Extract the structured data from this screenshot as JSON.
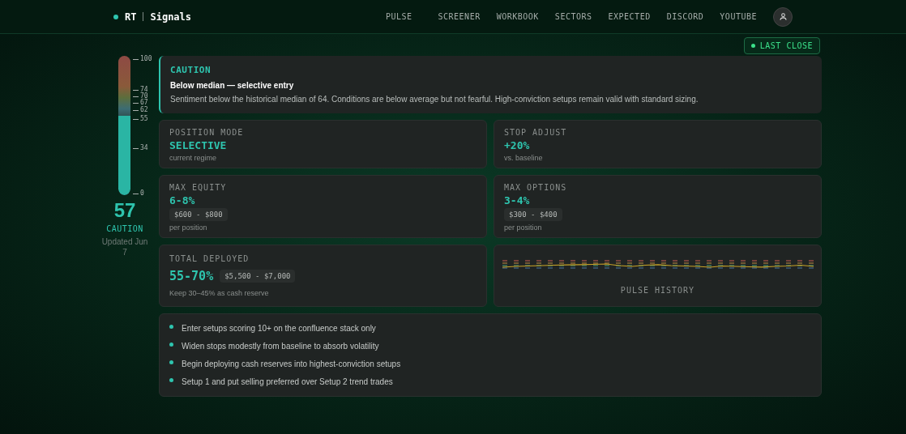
{
  "brand": {
    "name": "RT",
    "section": "Signals"
  },
  "nav": [
    "PULSE",
    "SCREENER",
    "WORKBOOK",
    "SECTORS",
    "EXPECTED",
    "DISCORD",
    "YOUTUBE"
  ],
  "status_badge": "LAST CLOSE",
  "gauge": {
    "level": 0.57,
    "ticks": [
      "100",
      "74",
      "70",
      "67",
      "62",
      "55",
      "34",
      "0"
    ],
    "reading": "57",
    "zone": "CAUTION",
    "updated": "Updated Jun 7"
  },
  "alert": {
    "title": "CAUTION",
    "subtitle": "Below median — selective entry",
    "body": "Sentiment below the historical median of 64. Conditions are below average but not fearful. High-conviction setups remain valid with standard sizing."
  },
  "cards": [
    {
      "label": "POSITION MODE",
      "value": "SELECTIVE",
      "sub": "current regime"
    },
    {
      "label": "STOP ADJUST",
      "value": "+20%",
      "sub": "vs. baseline"
    },
    {
      "label": "MAX EQUITY",
      "value": "6-8%",
      "range": "$600 - $800",
      "sub": "per position"
    },
    {
      "label": "MAX OPTIONS",
      "value": "3-4%",
      "range": "$300 - $400",
      "sub": "per position"
    }
  ],
  "deployed": {
    "label": "TOTAL DEPLOYED",
    "value": "55-70%",
    "range": "$5,500 - $7,000",
    "sub": "Keep 30–45% as cash reserve"
  },
  "history": {
    "label": "PULSE HISTORY"
  },
  "rules": [
    "Enter setups scoring 10+ on the confluence stack only",
    "Widen stops modestly from baseline to absorb volatility",
    "Begin deploying cash reserves into highest-conviction setups",
    "Setup 1 and put selling preferred over Setup 2 trend trades"
  ]
}
